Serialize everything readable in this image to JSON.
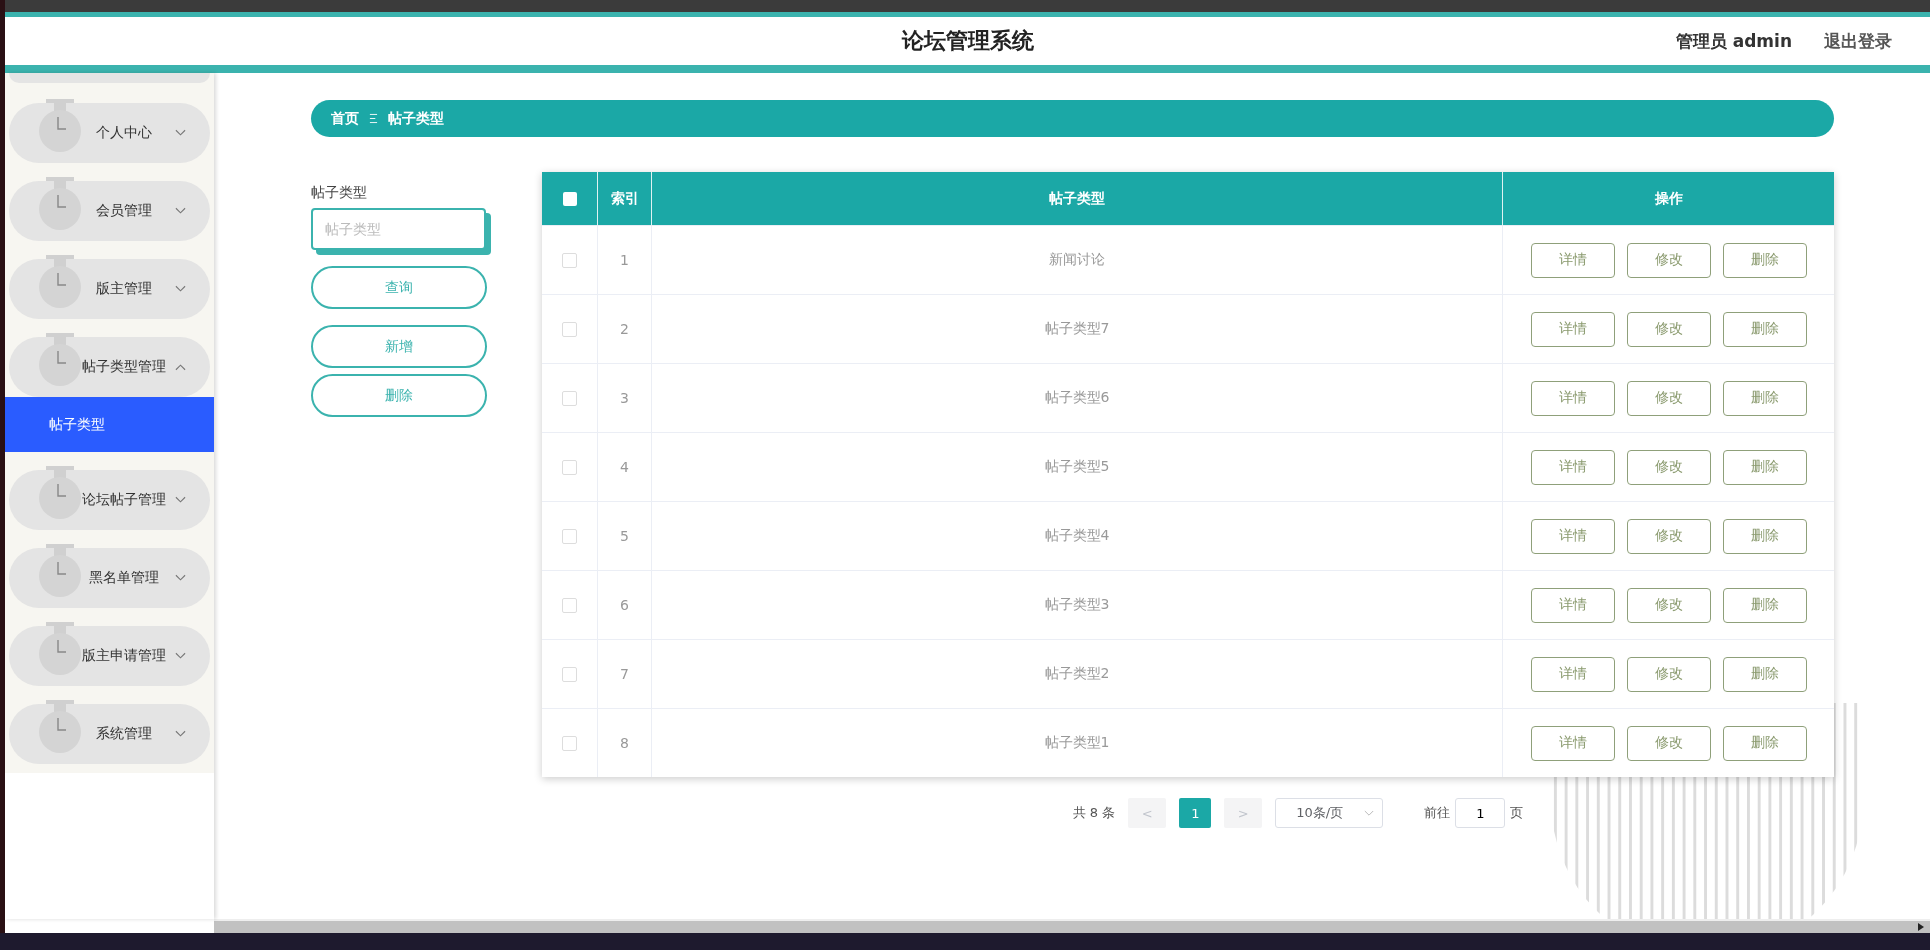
{
  "header": {
    "title": "论坛管理系统",
    "user": "管理员 admin",
    "logout": "退出登录"
  },
  "sidebar": {
    "items": [
      {
        "label": "个人中心",
        "expanded": false
      },
      {
        "label": "会员管理",
        "expanded": false
      },
      {
        "label": "版主管理",
        "expanded": false
      },
      {
        "label": "帖子类型管理",
        "expanded": true,
        "children": [
          {
            "label": "帖子类型",
            "selected": true
          }
        ]
      },
      {
        "label": "论坛帖子管理",
        "expanded": false
      },
      {
        "label": "黑名单管理",
        "expanded": false
      },
      {
        "label": "版主申请管理",
        "expanded": false
      },
      {
        "label": "系统管理",
        "expanded": false
      }
    ]
  },
  "breadcrumb": [
    "首页",
    "帖子类型"
  ],
  "search": {
    "label": "帖子类型",
    "placeholder": "帖子类型",
    "buttons": [
      "查询",
      "新增",
      "删除"
    ]
  },
  "table": {
    "columns": [
      "索引",
      "帖子类型",
      "操作"
    ],
    "all_checked": false,
    "rows": [
      {
        "checked": false,
        "index": "1",
        "type": "新闻讨论",
        "actions": [
          "详情",
          "修改",
          "删除"
        ]
      },
      {
        "checked": false,
        "index": "2",
        "type": "帖子类型7",
        "actions": [
          "详情",
          "修改",
          "删除"
        ]
      },
      {
        "checked": false,
        "index": "3",
        "type": "帖子类型6",
        "actions": [
          "详情",
          "修改",
          "删除"
        ]
      },
      {
        "checked": false,
        "index": "4",
        "type": "帖子类型5",
        "actions": [
          "详情",
          "修改",
          "删除"
        ]
      },
      {
        "checked": false,
        "index": "5",
        "type": "帖子类型4",
        "actions": [
          "详情",
          "修改",
          "删除"
        ]
      },
      {
        "checked": false,
        "index": "6",
        "type": "帖子类型3",
        "actions": [
          "详情",
          "修改",
          "删除"
        ]
      },
      {
        "checked": false,
        "index": "7",
        "type": "帖子类型2",
        "actions": [
          "详情",
          "修改",
          "删除"
        ]
      },
      {
        "checked": false,
        "index": "8",
        "type": "帖子类型1",
        "actions": [
          "详情",
          "修改",
          "删除"
        ]
      }
    ]
  },
  "pagination": {
    "total": "共 8 条",
    "prev": "<",
    "pages": [
      {
        "label": "1",
        "selected": true
      }
    ],
    "next": ">",
    "page_size": "10条/页",
    "goto_label": "前往",
    "goto_value": "1",
    "goto_suffix": "页"
  }
}
